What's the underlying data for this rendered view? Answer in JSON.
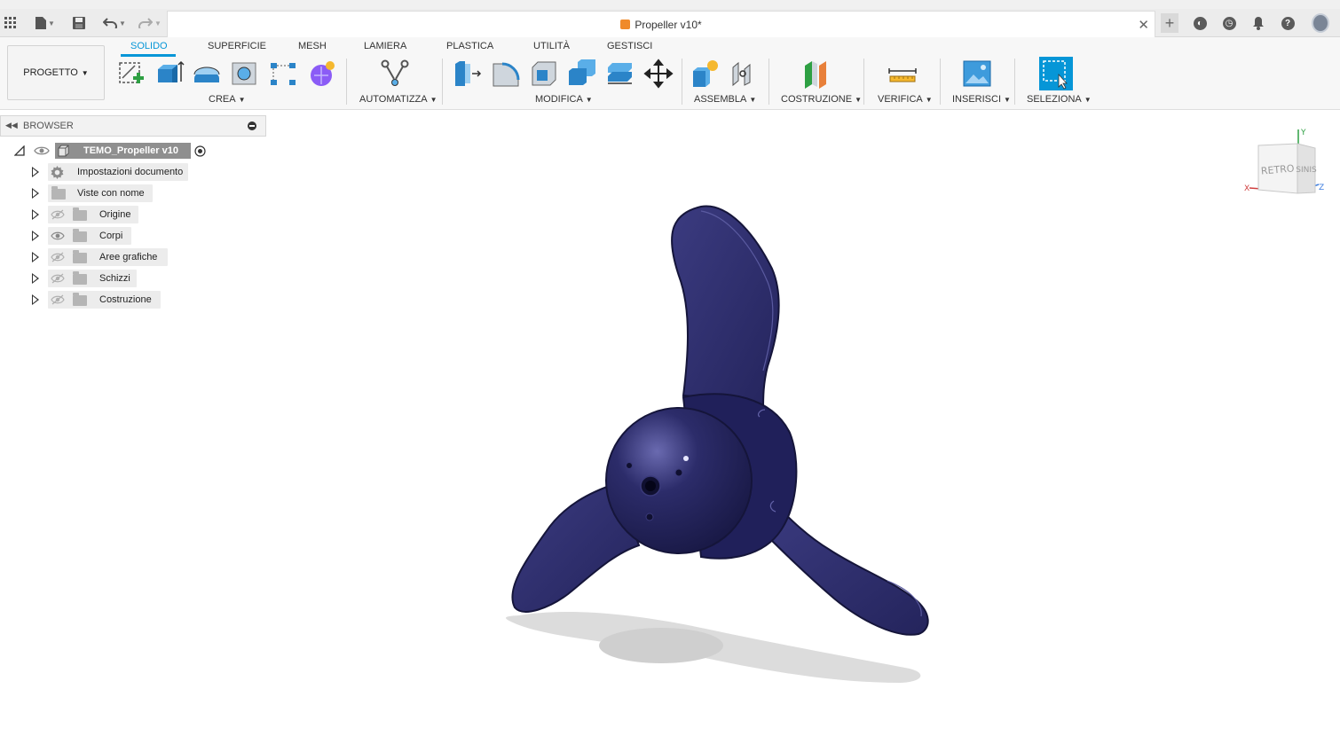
{
  "document": {
    "tab_title": "Propeller v10*"
  },
  "ribbon": {
    "project_button": "PROGETTO",
    "tabs": [
      "SOLIDO",
      "SUPERFICIE",
      "MESH",
      "LAMIERA",
      "PLASTICA",
      "UTILITÀ",
      "GESTISCI"
    ],
    "active_tab": "SOLIDO",
    "groups": {
      "crea": "CREA",
      "automatizza": "AUTOMATIZZA",
      "modifica": "MODIFICA",
      "assembla": "ASSEMBLA",
      "costruzione": "COSTRUZIONE",
      "verifica": "VERIFICA",
      "inserisci": "INSERISCI",
      "seleziona": "SELEZIONA"
    }
  },
  "browser": {
    "label": "BROWSER",
    "root": "TEMO_Propeller v10",
    "items": [
      {
        "label": "Impostazioni documento",
        "icon": "gear-icon"
      },
      {
        "label": "Viste con nome",
        "icon": "folder-icon"
      },
      {
        "label": "Origine",
        "icon": "folder-icon",
        "visible": false
      },
      {
        "label": "Corpi",
        "icon": "folder-icon",
        "visible": true
      },
      {
        "label": "Aree grafiche",
        "icon": "folder-icon",
        "visible": false
      },
      {
        "label": "Schizzi",
        "icon": "folder-icon",
        "visible": false
      },
      {
        "label": "Costruzione",
        "icon": "folder-icon",
        "visible": false
      }
    ]
  },
  "viewcube": {
    "face_back": "RETRO",
    "face_side": "SINIS",
    "axis_x": "X",
    "axis_y": "Y",
    "axis_z": "Z"
  },
  "colors": {
    "accent": "#0696d7",
    "model": "#2f2f6e",
    "background": "#ffffff"
  }
}
